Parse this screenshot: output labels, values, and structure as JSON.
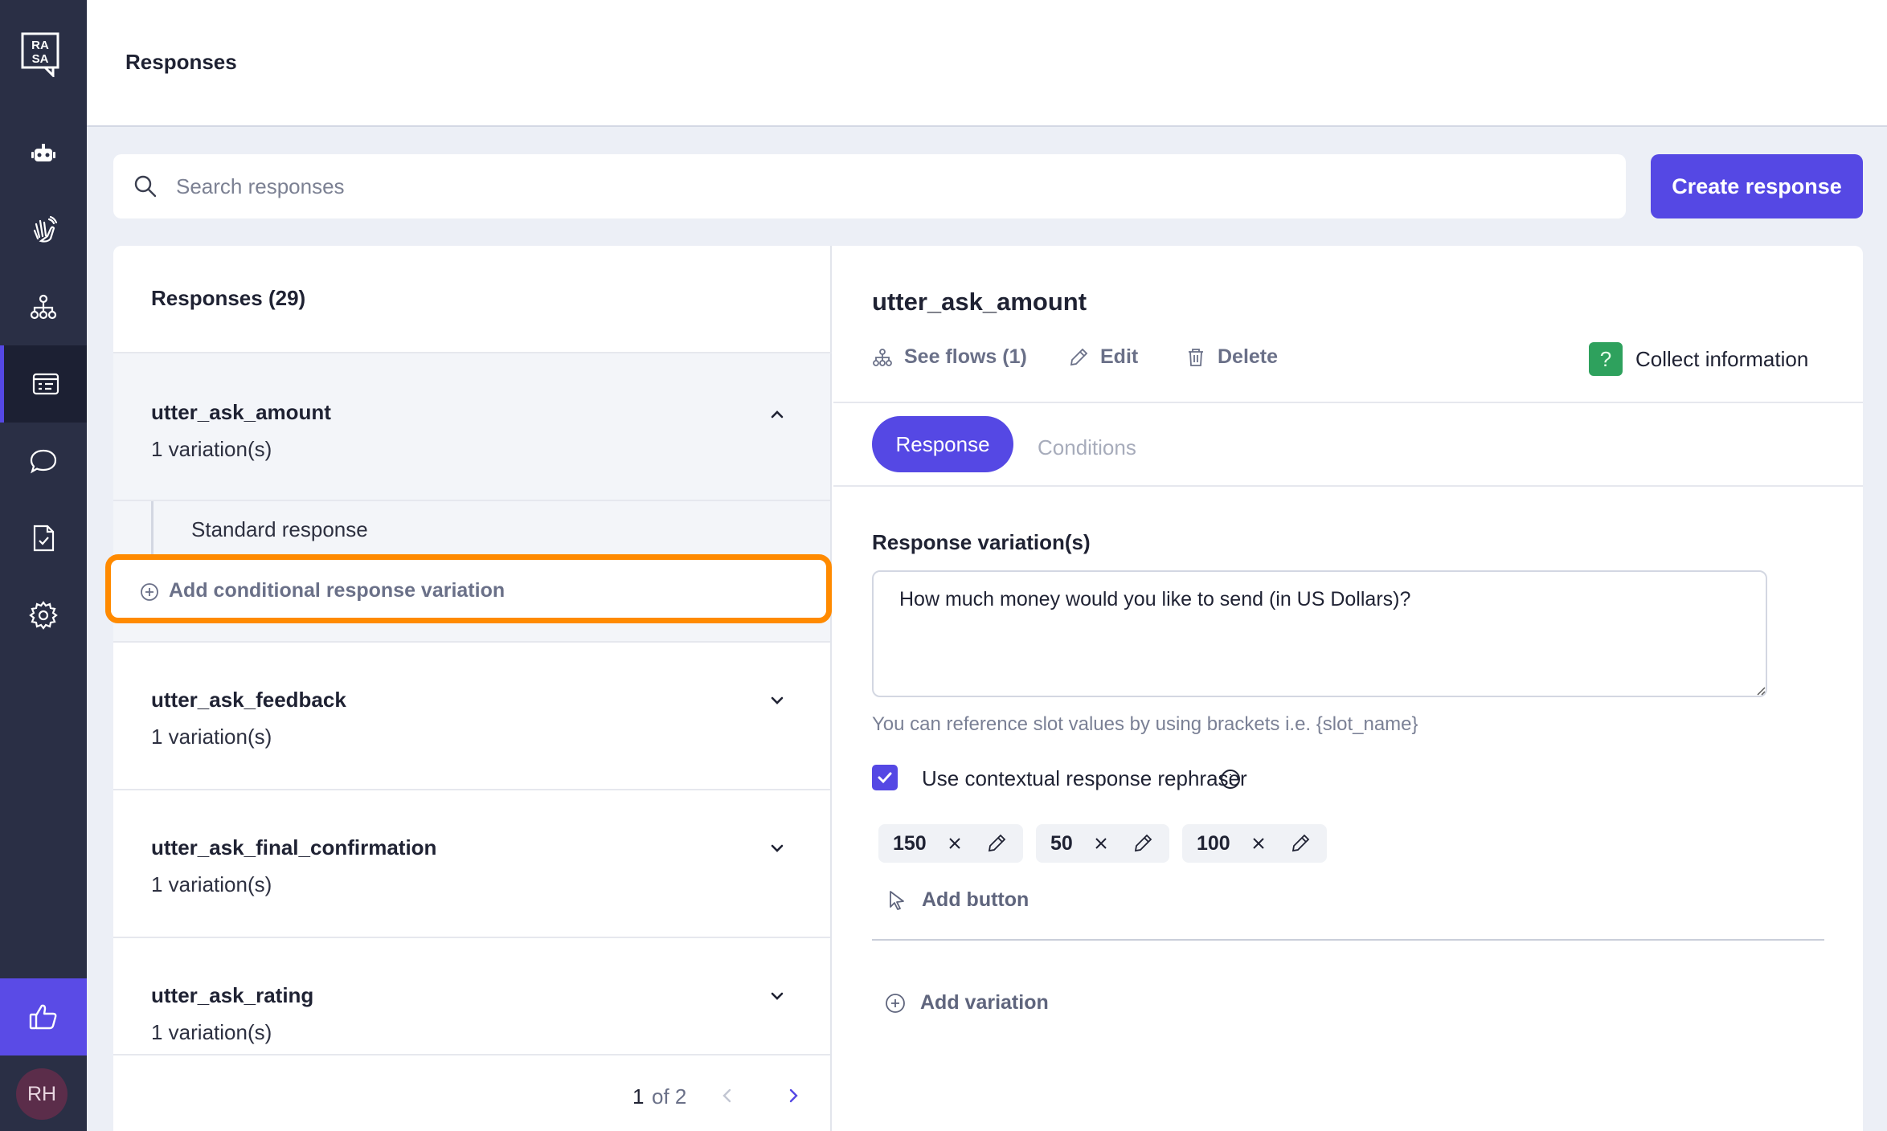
{
  "sidebar": {
    "logo_text": "RASA",
    "items": [
      {
        "icon": "robot-icon"
      },
      {
        "icon": "waving-hand-icon"
      },
      {
        "icon": "flows-icon"
      },
      {
        "icon": "responses-icon",
        "active": true
      },
      {
        "icon": "chat-bubble-icon"
      },
      {
        "icon": "clipboard-check-icon"
      },
      {
        "icon": "gear-icon"
      }
    ],
    "feedback_icon": "thumbs-up-icon",
    "avatar_initials": "RH"
  },
  "header": {
    "title": "Responses"
  },
  "search": {
    "placeholder": "Search responses"
  },
  "create_button_label": "Create response",
  "list": {
    "header": "Responses (29)",
    "items": [
      {
        "name": "utter_ask_amount",
        "variations": "1 variation(s)",
        "expanded": true
      },
      {
        "name": "utter_ask_feedback",
        "variations": "1 variation(s)"
      },
      {
        "name": "utter_ask_final_confirmation",
        "variations": "1 variation(s)"
      },
      {
        "name": "utter_ask_rating",
        "variations": "1 variation(s)"
      }
    ],
    "sub_items": {
      "standard": "Standard response",
      "add_conditional": "Add conditional response variation"
    },
    "pagination": {
      "current": "1",
      "of_text": "of 2"
    }
  },
  "detail": {
    "title": "utter_ask_amount",
    "actions": {
      "see_flows": "See flows (1)",
      "edit": "Edit",
      "delete": "Delete"
    },
    "collect_badge": {
      "symbol": "?",
      "label": "Collect information",
      "color": "#2ea15d"
    },
    "tabs": {
      "response": "Response",
      "conditions": "Conditions"
    },
    "section_label": "Response variation(s)",
    "variation_text": "How much money would you like to send (in US Dollars)?",
    "hint": "You can reference slot values by using brackets i.e. {slot_name}",
    "rephraser_label": "Use contextual response rephraser",
    "rephraser_checked": true,
    "buttons": [
      {
        "value": "150"
      },
      {
        "value": "50"
      },
      {
        "value": "100"
      }
    ],
    "add_button_label": "Add button",
    "add_variation_label": "Add variation"
  },
  "colors": {
    "accent": "#5548e4",
    "sidebar": "#2a2f45",
    "highlight": "#ff8a00"
  }
}
